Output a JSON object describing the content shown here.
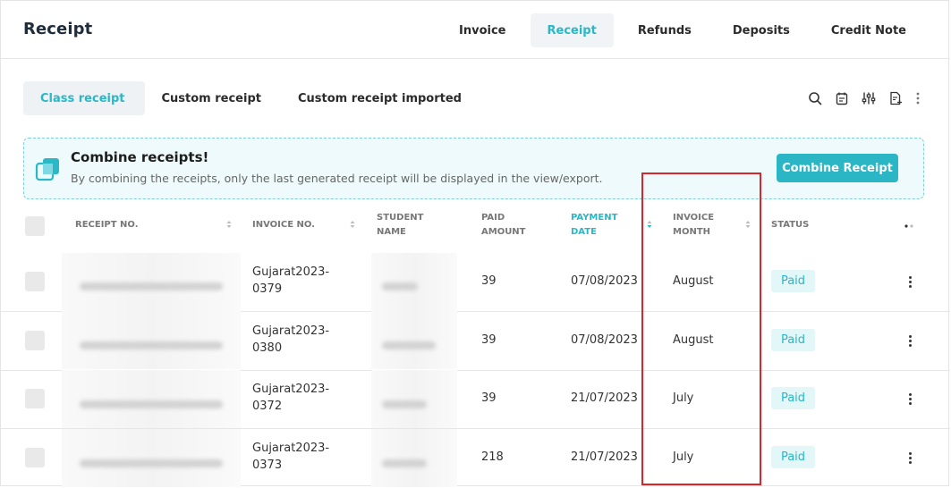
{
  "header": {
    "title": "Receipt",
    "tabs": [
      {
        "label": "Invoice"
      },
      {
        "label": "Receipt"
      },
      {
        "label": "Refunds"
      },
      {
        "label": "Deposits"
      },
      {
        "label": "Credit Note"
      }
    ],
    "active_tab": "Receipt"
  },
  "sub_tabs": [
    {
      "label": "Class receipt"
    },
    {
      "label": "Custom receipt"
    },
    {
      "label": "Custom receipt imported"
    }
  ],
  "active_sub_tab": "Class receipt",
  "toolbar": {
    "icons": [
      "search-icon",
      "calendar-icon",
      "filter-sliders-icon",
      "export-file-icon",
      "more-vertical-icon"
    ]
  },
  "banner": {
    "title": "Combine receipts!",
    "text": "By combining the receipts, only the last generated receipt will be displayed in the view/export.",
    "button_label": "Combine Receipt",
    "icon": "combine-icon"
  },
  "table": {
    "columns": [
      {
        "line1": "RECEIPT NO.",
        "line2": ""
      },
      {
        "line1": "INVOICE NO.",
        "line2": ""
      },
      {
        "line1": "STUDENT",
        "line2": "NAME"
      },
      {
        "line1": "PAID",
        "line2": "AMOUNT"
      },
      {
        "line1": "PAYMENT",
        "line2": "DATE"
      },
      {
        "line1": "INVOICE",
        "line2": "MONTH"
      },
      {
        "line1": "STATUS",
        "line2": ""
      }
    ],
    "rows": [
      {
        "invoice_line1": "Gujarat2023-",
        "invoice_line2": "0379",
        "paid_amount": "39",
        "payment_date": "07/08/2023",
        "invoice_month": "August",
        "status": "Paid"
      },
      {
        "invoice_line1": "Gujarat2023-",
        "invoice_line2": "0380",
        "paid_amount": "39",
        "payment_date": "07/08/2023",
        "invoice_month": "August",
        "status": "Paid"
      },
      {
        "invoice_line1": "Gujarat2023-",
        "invoice_line2": "0372",
        "paid_amount": "39",
        "payment_date": "21/07/2023",
        "invoice_month": "July",
        "status": "Paid"
      },
      {
        "invoice_line1": "Gujarat2023-",
        "invoice_line2": "0373",
        "paid_amount": "218",
        "payment_date": "21/07/2023",
        "invoice_month": "July",
        "status": "Paid"
      }
    ]
  },
  "colors": {
    "accent": "#2ab7c6",
    "highlight": "#d9252b",
    "badge_bg": "#e3f6f8"
  }
}
